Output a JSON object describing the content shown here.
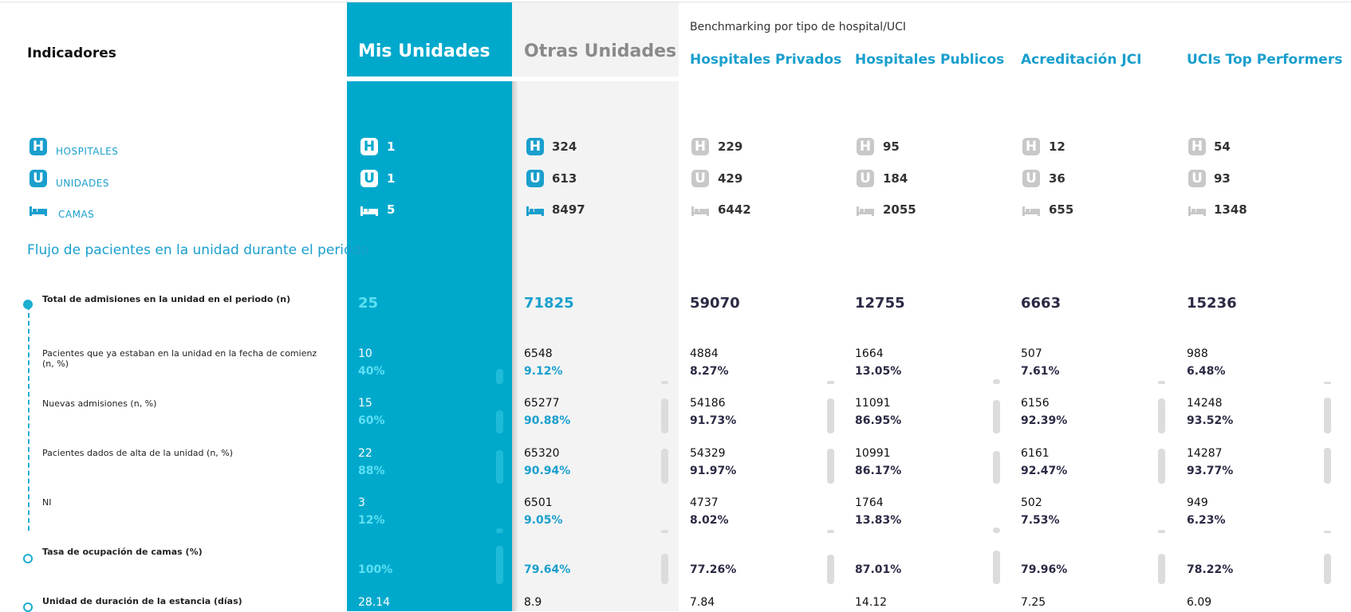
{
  "header": {
    "indicators": "Indicadores",
    "mis_unidades": "Mis Unidades",
    "otras_unidades": "Otras Unidades",
    "benchmark_title": "Benchmarking por tipo de hospital/UCI",
    "groups": [
      "Hospitales Privados",
      "Hospitales Publicos",
      "Acreditación JCI",
      "UCIs Top Performers"
    ]
  },
  "resources": {
    "hospitales_label": "HOSPITALES",
    "unidades_label": "UNIDADES",
    "camas_label": "CAMAS",
    "icon_hospital": "H",
    "icon_unidad": "U",
    "hospitales": [
      "1",
      "324",
      "229",
      "95",
      "12",
      "54"
    ],
    "unidades": [
      "1",
      "613",
      "429",
      "184",
      "36",
      "93"
    ],
    "camas": [
      "5",
      "8497",
      "6442",
      "2055",
      "655",
      "1348"
    ]
  },
  "section": {
    "title": "Flujo de pacientes en la unidad durante el periodo"
  },
  "rows": {
    "admisiones": {
      "label": "Total de admisiones en la unidad en el periodo (n)",
      "values": [
        "25",
        "71825",
        "59070",
        "12755",
        "6663",
        "15236"
      ]
    },
    "ya_estaban": {
      "label": "Pacientes que ya estaban en la unidad en la fecha de comienz (n, %)",
      "values": [
        "10",
        "6548",
        "4884",
        "1664",
        "507",
        "988"
      ],
      "pcts": [
        "40%",
        "9.12%",
        "8.27%",
        "13.05%",
        "7.61%",
        "6.48%"
      ]
    },
    "nuevas": {
      "label": "Nuevas admisiones (n, %)",
      "values": [
        "15",
        "65277",
        "54186",
        "11091",
        "6156",
        "14248"
      ],
      "pcts": [
        "60%",
        "90.88%",
        "91.73%",
        "86.95%",
        "92.39%",
        "93.52%"
      ]
    },
    "alta": {
      "label": "Pacientes dados de alta de la unidad (n, %)",
      "values": [
        "22",
        "65320",
        "54329",
        "10991",
        "6161",
        "14287"
      ],
      "pcts": [
        "88%",
        "90.94%",
        "91.97%",
        "86.17%",
        "92.47%",
        "93.77%"
      ]
    },
    "ni": {
      "label": "NI",
      "values": [
        "3",
        "6501",
        "4737",
        "1764",
        "502",
        "949"
      ],
      "pcts": [
        "12%",
        "9.05%",
        "8.02%",
        "13.83%",
        "7.53%",
        "6.23%"
      ]
    },
    "ocupacion": {
      "label": "Tasa de ocupación de camas (%)",
      "pcts": [
        "100%",
        "79.64%",
        "77.26%",
        "87.01%",
        "79.96%",
        "78.22%"
      ]
    },
    "estancia": {
      "label": "Unidad de duración de la estancia (días)",
      "values": [
        "28.14",
        "8.9",
        "7.84",
        "14.12",
        "7.25",
        "6.09"
      ]
    }
  },
  "bar_levels": {
    "ya_estaban": [
      0.4,
      0.0912,
      0.0827,
      0.1305,
      0.0761,
      0.0648
    ],
    "nuevas": [
      0.6,
      0.9088,
      0.9173,
      0.8695,
      0.9239,
      0.9352
    ],
    "alta": [
      0.88,
      0.9094,
      0.9197,
      0.8617,
      0.9247,
      0.9377
    ],
    "ni": [
      0.12,
      0.0905,
      0.0802,
      0.1383,
      0.0753,
      0.0623
    ],
    "ocupacion": [
      1.0,
      0.7964,
      0.7726,
      0.8701,
      0.7996,
      0.7822
    ]
  },
  "colors": {
    "mis_col": "#00a9cc",
    "accent": "#1a9fcd",
    "highlight": "#5ce0f3",
    "otras_col": "#f3f3f3"
  }
}
